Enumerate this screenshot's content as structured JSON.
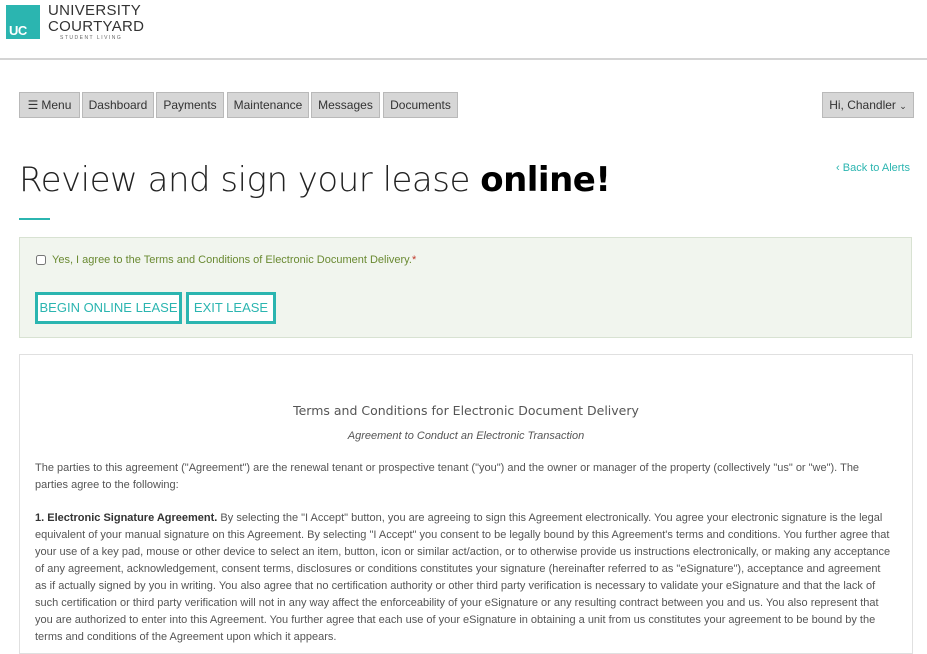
{
  "brand": {
    "logo_initials": "UC",
    "name_line1": "UNIVERSITY",
    "name_line2": "COURTYARD",
    "tagline": "STUDENT LIVING",
    "color": "#2bb5b0"
  },
  "nav": {
    "menu": "Menu",
    "items": [
      "Dashboard",
      "Payments",
      "Maintenance",
      "Messages",
      "Documents"
    ],
    "user": "Hi, Chandler"
  },
  "page": {
    "title_light": "Review and sign your lease ",
    "title_bold": "online!",
    "back_link": "Back to Alerts"
  },
  "agreement": {
    "checkbox_label": "Yes, I agree to the Terms and Conditions of Electronic Document Delivery.",
    "required_mark": "*",
    "checked": false,
    "begin_button": "BEGIN ONLINE LEASE",
    "exit_button": "EXIT LEASE"
  },
  "terms": {
    "title": "Terms and Conditions for Electronic Document Delivery",
    "subtitle": "Agreement to Conduct an Electronic Transaction",
    "intro": "The parties to this agreement (\"Agreement\") are the renewal tenant or prospective tenant (\"you\") and the owner or manager of the property (collectively \"us\" or \"we\"). The parties agree to the following:",
    "section1_heading": "1. Electronic Signature Agreement.",
    "section1_body": " By selecting the \"I Accept\" button, you are agreeing to sign this Agreement electronically. You agree your electronic signature is the legal equivalent of your manual signature on this Agreement. By selecting \"I Accept\" you consent to be legally bound by this Agreement's terms and conditions. You further agree that your use of a key pad, mouse or other device to select an item, button, icon or similar act/action, or to otherwise provide us instructions electronically, or making any acceptance of any agreement, acknowledgement, consent terms, disclosures or conditions constitutes your signature (hereinafter referred to as \"eSignature\"), acceptance and agreement as if actually signed by you in writing. You also agree that no certification authority or other third party verification is necessary to validate your eSignature and that the lack of such certification or third party verification will not in any way affect the enforceability of your eSignature or any resulting contract between you and us. You also represent that you are authorized to enter into this Agreement. You further agree that each use of your eSignature in obtaining a unit from us constitutes your agreement to be bound by the terms and conditions of the Agreement upon which it appears."
  }
}
